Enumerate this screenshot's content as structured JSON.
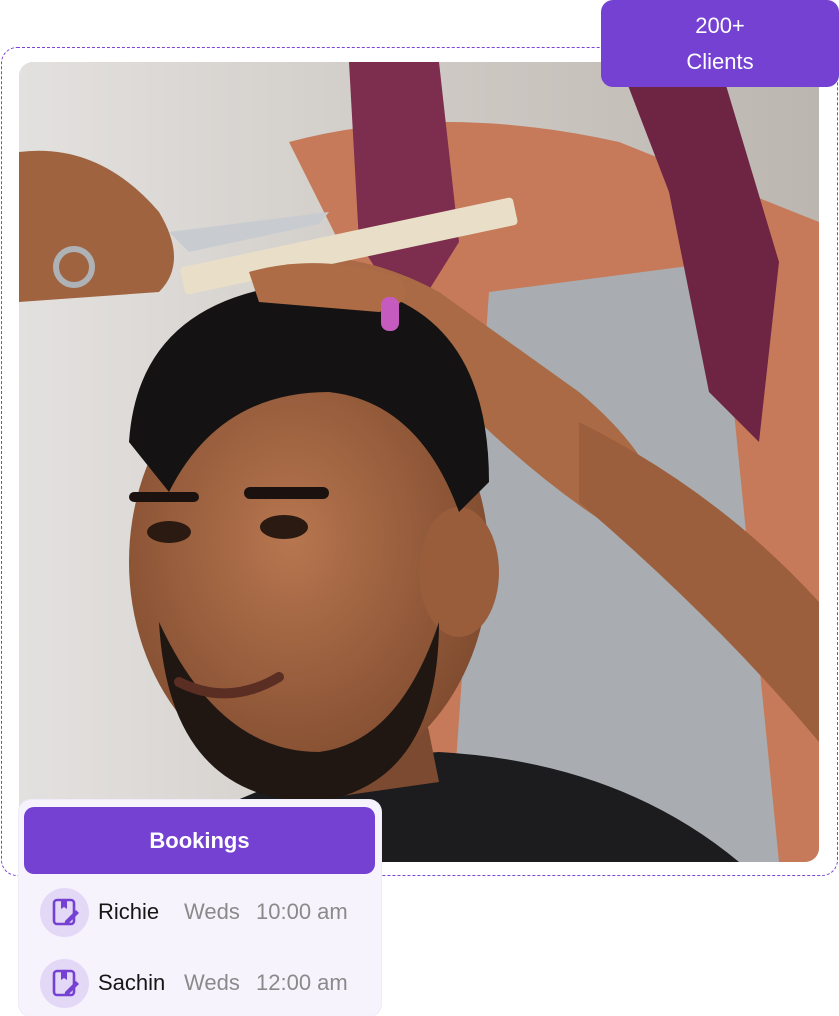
{
  "badge": {
    "count": "200+",
    "label": "Clients"
  },
  "photo": {
    "alt_icon": "barber-haircut-photo"
  },
  "bookings": {
    "title": "Bookings",
    "items": [
      {
        "name": "Richie",
        "day": "Weds",
        "time": "10:00 am",
        "icon": "booking-edit-icon"
      },
      {
        "name": "Sachin",
        "day": "Weds",
        "time": "12:00 am",
        "icon": "booking-edit-icon"
      }
    ]
  },
  "colors": {
    "accent": "#7441d3",
    "card_bg": "#f7f3fd",
    "icon_bg": "#e4d8f7"
  }
}
